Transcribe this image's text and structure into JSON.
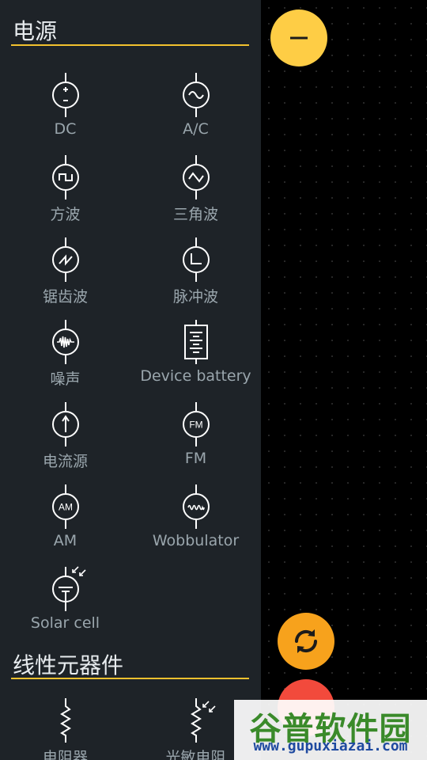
{
  "sections": [
    {
      "title": "电源"
    },
    {
      "title": "线性元器件"
    }
  ],
  "power_items": [
    {
      "label": "DC",
      "icon": "dc-source-icon"
    },
    {
      "label": "A/C",
      "icon": "ac-source-icon"
    },
    {
      "label": "方波",
      "icon": "square-wave-icon"
    },
    {
      "label": "三角波",
      "icon": "triangle-wave-icon"
    },
    {
      "label": "锯齿波",
      "icon": "sawtooth-wave-icon"
    },
    {
      "label": "脉冲波",
      "icon": "pulse-wave-icon"
    },
    {
      "label": "噪声",
      "icon": "noise-icon"
    },
    {
      "label": "Device battery",
      "icon": "battery-icon"
    },
    {
      "label": "电流源",
      "icon": "current-source-icon"
    },
    {
      "label": "FM",
      "icon": "fm-source-icon",
      "badge": "FM"
    },
    {
      "label": "AM",
      "icon": "am-source-icon",
      "badge": "AM"
    },
    {
      "label": "Wobbulator",
      "icon": "wobbulator-icon"
    },
    {
      "label": "Solar cell",
      "icon": "solar-cell-icon"
    }
  ],
  "linear_items": [
    {
      "label": "电阻器",
      "icon": "resistor-icon"
    },
    {
      "label": "光敏电阻",
      "icon": "photoresistor-icon"
    }
  ],
  "buttons": {
    "collapse": "minus-icon",
    "refresh": "refresh-icon"
  },
  "watermark": {
    "title": "谷普软件园",
    "url": "www.gupuxiazai.com"
  },
  "colors": {
    "panel": "#1e2328",
    "accent": "#f2c12e",
    "label": "#9aa6ad",
    "fab_yellow": "#fecd45",
    "fab_orange": "#f7a21c",
    "fab_red": "#f24a3c"
  }
}
